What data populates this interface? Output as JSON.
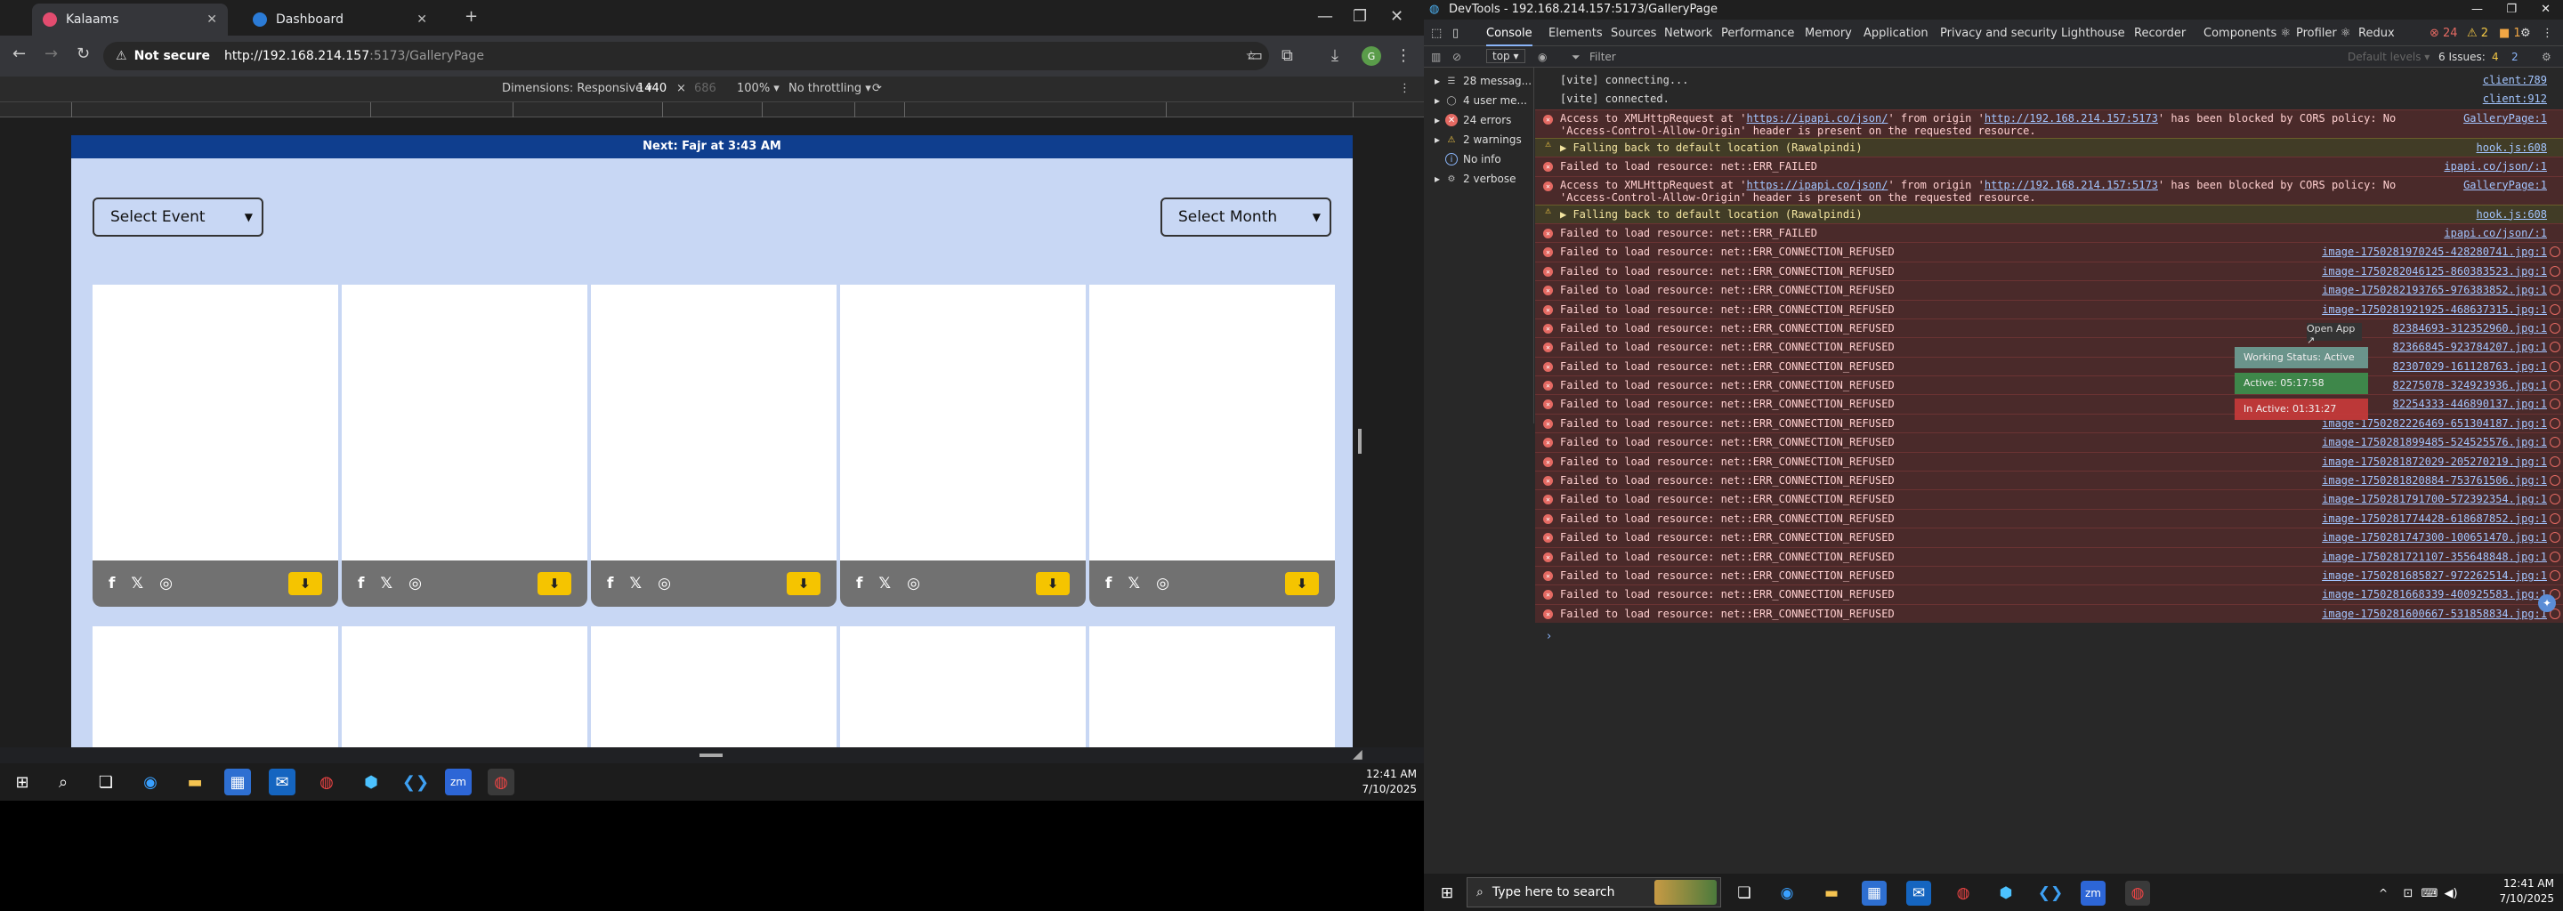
{
  "browser": {
    "tabs": [
      {
        "title": "Kalaams",
        "favicon_color": "#e34c6f"
      },
      {
        "title": "Dashboard",
        "favicon_color": "#2b7bd6"
      }
    ],
    "url": {
      "security": "Not secure",
      "host": "http://192.168.214.157",
      "path": ":5173/GalleryPage"
    },
    "device_toolbar": {
      "dimensions": "Dimensions: Responsive ▾",
      "width": "1440",
      "times": "×",
      "height": "686",
      "zoom": "100% ▾",
      "throttling": "No throttling ▾"
    }
  },
  "page": {
    "banner": "Next: Fajr at 3:43 AM",
    "select_event": "Select Event",
    "select_month": "Select Month",
    "card_count": 5
  },
  "left_taskbar": {
    "time": "12:41 AM",
    "date": "7/10/2025"
  },
  "devtools": {
    "title": "DevTools - 192.168.214.157:5173/GalleryPage",
    "tabs": [
      "Console",
      "Elements",
      "Sources",
      "Network",
      "Performance",
      "Memory",
      "Application",
      "Privacy and security",
      "Lighthouse",
      "Recorder",
      "Components ⚛",
      "Profiler ⚛",
      "Redux"
    ],
    "top_counts": {
      "errors": "24",
      "warnings": "2",
      "info": "1"
    },
    "context": "top ▾",
    "filter_placeholder": "Filter",
    "levels": "Default levels ▾",
    "issues": "6 Issues:",
    "issues_w": "4",
    "issues_i": "2",
    "sidebar": [
      {
        "label": "28 messag...",
        "kind": "list"
      },
      {
        "label": "4 user me...",
        "kind": "user"
      },
      {
        "label": "24 errors",
        "kind": "error"
      },
      {
        "label": "2 warnings",
        "kind": "warning"
      },
      {
        "label": "No info",
        "kind": "info"
      },
      {
        "label": "2 verbose",
        "kind": "verbose"
      }
    ],
    "logs": [
      {
        "type": "info",
        "text": "[vite] connecting...",
        "src": "client:789"
      },
      {
        "type": "info",
        "text": "[vite] connected.",
        "src": "client:912"
      },
      {
        "type": "err",
        "tall": true,
        "prefix": "Access to XMLHttpRequest at '",
        "link1": "https://ipapi.co/json/",
        "mid": "' from origin '",
        "link2": "http://192.168.214.157:5173",
        "suffix": "' has been blocked by CORS policy: No 'Access-Control-Allow-Origin' header is present on the requested resource.",
        "src": "GalleryPage:1"
      },
      {
        "type": "warn",
        "text": "▶ Falling back to default location (Rawalpindi)",
        "src": "hook.js:608"
      },
      {
        "type": "err",
        "text": "Failed to load resource: net::ERR_FAILED",
        "src": "ipapi.co/json/:1"
      },
      {
        "type": "err",
        "tall": true,
        "prefix": "Access to XMLHttpRequest at '",
        "link1": "https://ipapi.co/json/",
        "mid": "' from origin '",
        "link2": "http://192.168.214.157:5173",
        "suffix": "' has been blocked by CORS policy: No 'Access-Control-Allow-Origin' header is present on the requested resource.",
        "src": "GalleryPage:1"
      },
      {
        "type": "warn",
        "text": "▶ Falling back to default location (Rawalpindi)",
        "src": "hook.js:608"
      },
      {
        "type": "err",
        "text": "Failed to load resource: net::ERR_FAILED",
        "src": "ipapi.co/json/:1"
      },
      {
        "type": "err",
        "text": "Failed to load resource: net::ERR_CONNECTION_REFUSED",
        "src": "image-1750281970245-428280741.jpg:1"
      },
      {
        "type": "err",
        "text": "Failed to load resource: net::ERR_CONNECTION_REFUSED",
        "src": "image-1750282046125-860383523.jpg:1"
      },
      {
        "type": "err",
        "text": "Failed to load resource: net::ERR_CONNECTION_REFUSED",
        "src": "image-1750282193765-976383852.jpg:1"
      },
      {
        "type": "err",
        "text": "Failed to load resource: net::ERR_CONNECTION_REFUSED",
        "src": "image-1750281921925-468637315.jpg:1"
      },
      {
        "type": "err",
        "text": "Failed to load resource: net::ERR_CONNECTION_REFUSED",
        "src": "82384693-312352960.jpg:1"
      },
      {
        "type": "err",
        "text": "Failed to load resource: net::ERR_CONNECTION_REFUSED",
        "src": "82366845-923784207.jpg:1"
      },
      {
        "type": "err",
        "text": "Failed to load resource: net::ERR_CONNECTION_REFUSED",
        "src": "82307029-161128763.jpg:1"
      },
      {
        "type": "err",
        "text": "Failed to load resource: net::ERR_CONNECTION_REFUSED",
        "src": "82275078-324923936.jpg:1"
      },
      {
        "type": "err",
        "text": "Failed to load resource: net::ERR_CONNECTION_REFUSED",
        "src": "82254333-446890137.jpg:1"
      },
      {
        "type": "err",
        "text": "Failed to load resource: net::ERR_CONNECTION_REFUSED",
        "src": "image-1750282226469-651304187.jpg:1"
      },
      {
        "type": "err",
        "text": "Failed to load resource: net::ERR_CONNECTION_REFUSED",
        "src": "image-1750281899485-524525576.jpg:1"
      },
      {
        "type": "err",
        "text": "Failed to load resource: net::ERR_CONNECTION_REFUSED",
        "src": "image-1750281872029-205270219.jpg:1"
      },
      {
        "type": "err",
        "text": "Failed to load resource: net::ERR_CONNECTION_REFUSED",
        "src": "image-1750281820884-753761506.jpg:1"
      },
      {
        "type": "err",
        "text": "Failed to load resource: net::ERR_CONNECTION_REFUSED",
        "src": "image-1750281791700-572392354.jpg:1"
      },
      {
        "type": "err",
        "text": "Failed to load resource: net::ERR_CONNECTION_REFUSED",
        "src": "image-1750281774428-618687852.jpg:1"
      },
      {
        "type": "err",
        "text": "Failed to load resource: net::ERR_CONNECTION_REFUSED",
        "src": "image-1750281747300-100651470.jpg:1"
      },
      {
        "type": "err",
        "text": "Failed to load resource: net::ERR_CONNECTION_REFUSED",
        "src": "image-1750281721107-355648848.jpg:1"
      },
      {
        "type": "err",
        "text": "Failed to load resource: net::ERR_CONNECTION_REFUSED",
        "src": "image-1750281685827-972262514.jpg:1"
      },
      {
        "type": "err",
        "text": "Failed to load resource: net::ERR_CONNECTION_REFUSED",
        "src": "image-1750281668339-400925583.jpg:1"
      },
      {
        "type": "err",
        "text": "Failed to load resource: net::ERR_CONNECTION_REFUSED",
        "src": "image-1750281600667-531858834.jpg:1"
      }
    ],
    "prompt": "›"
  },
  "working_status": {
    "open_app": "Open App ↗",
    "status": "Working Status: Active",
    "active": "Active: 05:17:58",
    "inactive": "In Active: 01:31:27"
  },
  "right_taskbar": {
    "search_placeholder": "Type here to search",
    "time": "12:41 AM",
    "date": "7/10/2025"
  },
  "colors": {
    "banner": "#0f3e8e",
    "page_bg": "#c8d7f4",
    "download": "#f5c400",
    "card_bar": "#717171",
    "error_bg": "#4a2a2a",
    "warn_bg": "#413c26"
  }
}
